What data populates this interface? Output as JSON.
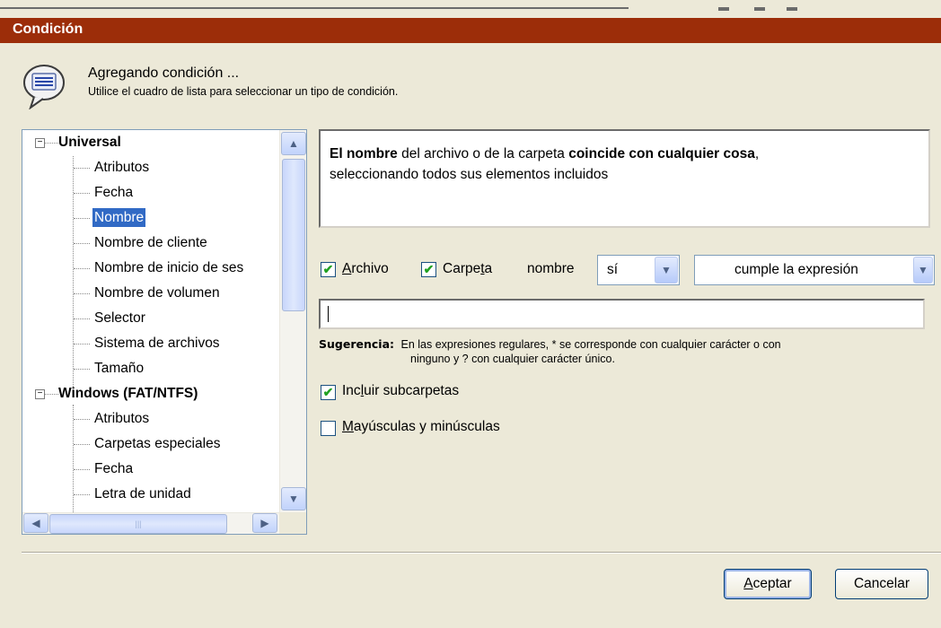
{
  "dialog": {
    "title": "Condición"
  },
  "header": {
    "title": "Agregando condición ...",
    "subtitle": "Utilice el cuadro de lista para seleccionar un tipo de condición."
  },
  "tree": {
    "groups": [
      {
        "label": "Universal",
        "items": [
          "Atributos",
          "Fecha",
          "Nombre",
          "Nombre de cliente",
          "Nombre de inicio de ses",
          "Nombre de volumen",
          "Selector",
          "Sistema de archivos",
          "Tamaño"
        ]
      },
      {
        "label": "Windows (FAT/NTFS)",
        "items": [
          "Atributos",
          "Carpetas especiales",
          "Fecha",
          "Letra de unidad"
        ]
      }
    ],
    "selected": "Nombre"
  },
  "description": {
    "bold1": "El nombre",
    "text1": " del archivo o de la carpeta ",
    "bold2": "coincide con cualquier cosa",
    "text2": ",",
    "line2": "seleccionando todos sus elementos incluidos"
  },
  "options": {
    "archivo": {
      "pre": "",
      "u": "A",
      "post": "rchivo",
      "checked": true
    },
    "carpeta": {
      "pre": "Carpe",
      "u": "t",
      "post": "a",
      "checked": true
    },
    "nombre_label": "nombre",
    "si_combo": "sí",
    "expr_combo": "cumple la expresión",
    "input_value": "",
    "hint_label": "Sugerencia:",
    "hint_text1": "En las expresiones regulares, * se corresponde con cualquier carácter o con",
    "hint_text2": "ninguno y ? con cualquier carácter único.",
    "incluir": {
      "pre": "Inc",
      "u": "l",
      "post": "uir subcarpetas",
      "checked": true
    },
    "mayus": {
      "pre": "",
      "u": "M",
      "post": "ayúsculas y minúsculas",
      "checked": false
    }
  },
  "buttons": {
    "ok": {
      "u": "A",
      "post": "ceptar"
    },
    "cancel": "Cancelar"
  },
  "colors": {
    "titlebar": "#9c2d09",
    "selection": "#316ac5",
    "check": "#21a121"
  }
}
